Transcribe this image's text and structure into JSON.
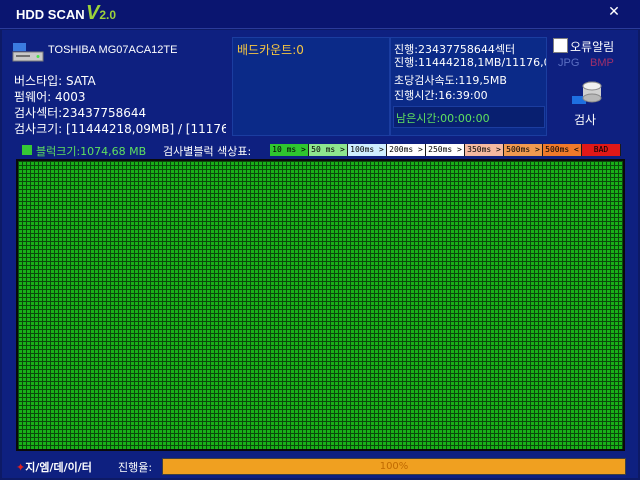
{
  "app": {
    "title": "HDD SCAN",
    "version_major": "V",
    "version_minor": "2.0"
  },
  "drive": {
    "name": "TOSHIBA MG07ACA12TE",
    "bus_type": "버스타입: SATA",
    "firmware": "펌웨어: 4003",
    "sectors": "검사섹터:23437758644",
    "size": "검사크기: [11444218,09MB] / [11176,0"
  },
  "bad": {
    "label": "배드카운트:0"
  },
  "progress_panel": {
    "line1": "진행:23437758644섹터",
    "line2": "진행:11444218,1MB/11176,0",
    "speed": "초당검사속도:119,5MB",
    "elapsed": "진행시간:16:39:00",
    "remaining": "남은시간:00:00:00"
  },
  "options": {
    "error_alarm": "오류알림",
    "jpg": "JPG",
    "bmp": "BMP",
    "scan_button": "검사"
  },
  "blocks": {
    "size_label": "블럭크기:1074,68 MB",
    "legend_title": "검사별블럭 색상표:"
  },
  "legend": [
    {
      "label": "10 ms >",
      "color": "#2fc62f"
    },
    {
      "label": "50 ms >",
      "color": "#8ee68e"
    },
    {
      "label": "100ms >",
      "color": "#cfeeff"
    },
    {
      "label": "200ms >",
      "color": "#ffffff"
    },
    {
      "label": "250ms >",
      "color": "#ffffff"
    },
    {
      "label": "350ms >",
      "color": "#f5b9a0"
    },
    {
      "label": "500ms >",
      "color": "#f09a50"
    },
    {
      "label": "500ms <",
      "color": "#f07a2a"
    },
    {
      "label": "BAD",
      "color": "#e01818"
    }
  ],
  "footer": {
    "logo_star": "✦",
    "logo": "지/엠/데/이/터",
    "progress_label": "진행율:",
    "progress_value": "100%",
    "progress_fraction": 1.0
  },
  "colors": {
    "accent_green": "#19b019",
    "progress_orange": "#f0a020"
  }
}
